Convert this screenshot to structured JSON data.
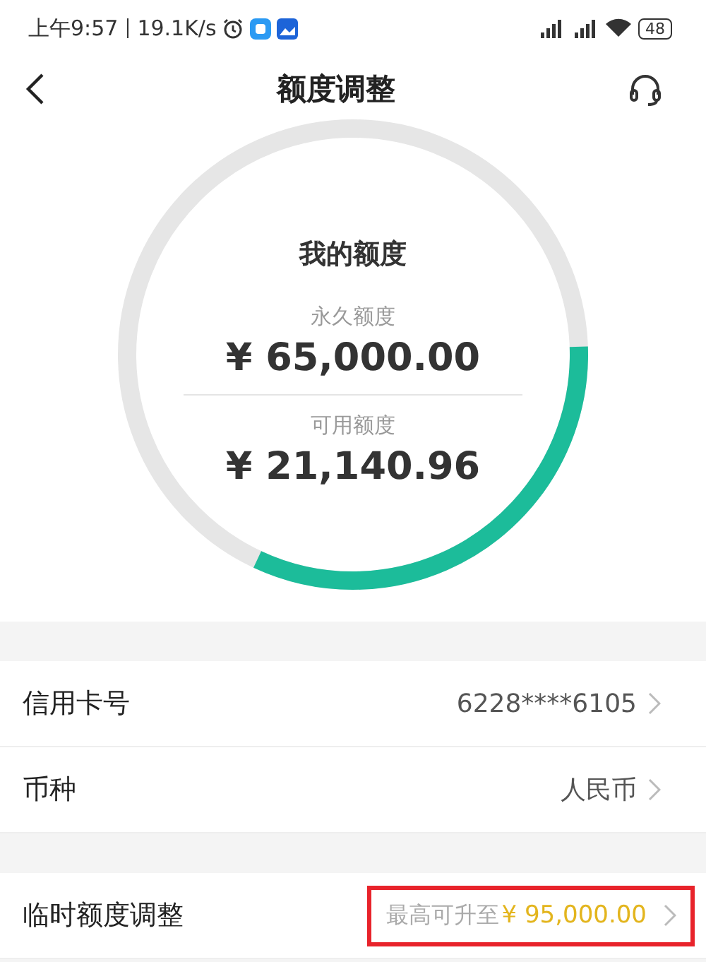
{
  "status_bar": {
    "time": "上午9:57",
    "speed": "19.1K/s",
    "battery": "48"
  },
  "header": {
    "title": "额度调整"
  },
  "gauge": {
    "title": "我的额度",
    "level": 0.325,
    "items": [
      {
        "label": "永久额度",
        "amount": "¥ 65,000.00"
      },
      {
        "label": "可用额度",
        "amount": "¥ 21,140.96"
      }
    ]
  },
  "groups": [
    [
      {
        "label": "信用卡号",
        "value": "6228****6105",
        "highlighted": false
      },
      {
        "label": "币种",
        "value": "人民币",
        "highlighted": false
      }
    ],
    [
      {
        "label": "临时额度调整",
        "value": "最高可升至",
        "amount": "¥ 95,000.00",
        "highlighted": true
      }
    ]
  ]
}
